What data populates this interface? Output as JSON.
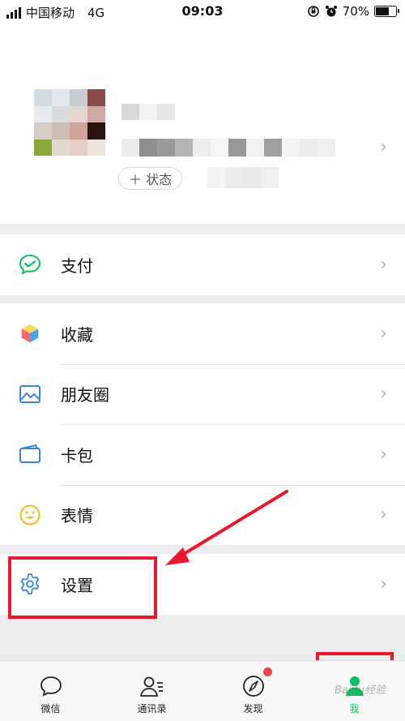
{
  "status_bar": {
    "carrier": "中国移动",
    "network": "4G",
    "time": "09:03",
    "battery": "70%",
    "battery_level": 0.7
  },
  "profile": {
    "status_button_label": "＋ 状态",
    "chevron": "›"
  },
  "menu": {
    "pay": {
      "label": "支付",
      "icon": "pay-icon"
    },
    "favorites": {
      "label": "收藏",
      "icon": "favorites-cube-icon"
    },
    "moments": {
      "label": "朋友圈",
      "icon": "moments-image-icon"
    },
    "cards": {
      "label": "卡包",
      "icon": "card-wallet-icon"
    },
    "stickers": {
      "label": "表情",
      "icon": "smile-icon"
    },
    "settings": {
      "label": "设置",
      "icon": "gear-icon"
    },
    "chevron": "›"
  },
  "tabs": [
    {
      "label": "微信",
      "icon": "chat-bubble-icon",
      "active": false
    },
    {
      "label": "通讯录",
      "icon": "contacts-icon",
      "active": false
    },
    {
      "label": "发现",
      "icon": "compass-icon",
      "active": false,
      "badge": true
    },
    {
      "label": "我",
      "icon": "me-person-icon",
      "active": true
    }
  ],
  "colors": {
    "accent": "#07c160",
    "highlight": "#e8192c",
    "badge": "#f2434a",
    "chevron": "#b2b2b2"
  },
  "watermark": "Baidu经验"
}
